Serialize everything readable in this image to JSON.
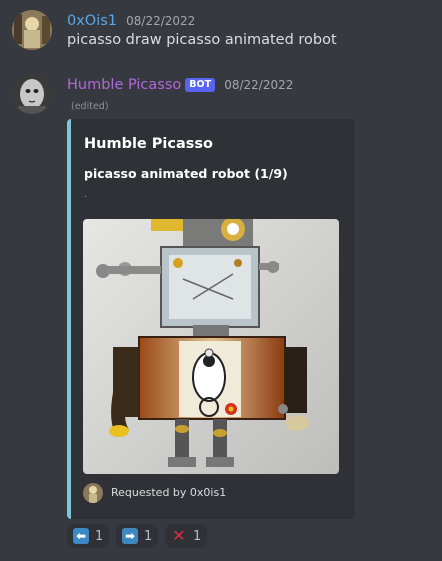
{
  "messages": [
    {
      "username": "0xOis1",
      "timestamp": "08/22/2022",
      "content": "picasso draw picasso animated robot"
    },
    {
      "username": "Humble Picasso",
      "bot_tag": "BOT",
      "timestamp": "08/22/2022",
      "edited": "(edited)",
      "embed": {
        "title": "Humble Picasso",
        "description": "picasso animated robot (1/9)",
        "spacer": ".",
        "footer": "Requested by 0x0is1",
        "accent_color": "#7ec6d6"
      }
    }
  ],
  "reactions": [
    {
      "icon": "arrow-left-icon",
      "glyph": "⬅",
      "count": "1"
    },
    {
      "icon": "arrow-right-icon",
      "glyph": "➡",
      "count": "1"
    },
    {
      "icon": "cross-mark-icon",
      "glyph": "✕",
      "count": "1"
    }
  ],
  "colors": {
    "background": "#36393f",
    "embed_bg": "#2f3136",
    "user1": "#5aa8e6",
    "user2": "#b168d8",
    "bot_tag": "#5865f2"
  }
}
